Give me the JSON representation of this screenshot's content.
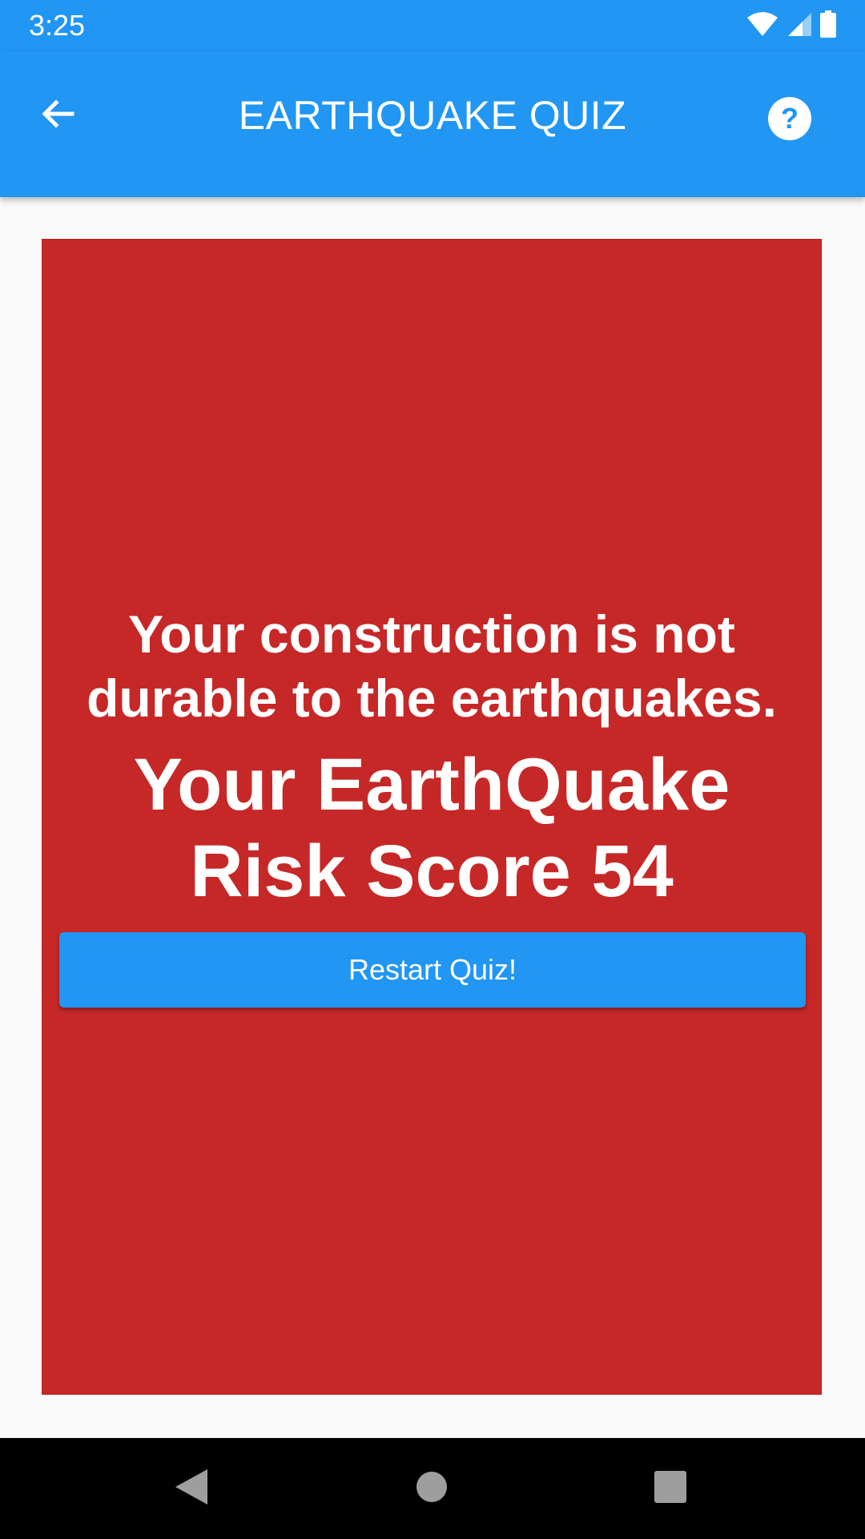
{
  "status_bar": {
    "time": "3:25",
    "icons": [
      "wifi-icon",
      "cellular-signal-icon",
      "battery-icon"
    ]
  },
  "app_bar": {
    "title": "EARTHQUAKE QUIZ",
    "back_icon": "arrow-back-icon",
    "help_icon": "help-circle-icon",
    "color": "#2196f3"
  },
  "result": {
    "message": "Your construction is not durable to the earthquakes.",
    "score_text": "Your EarthQuake Risk Score 54",
    "card_color": "#c62828",
    "button_label": "Restart Quiz!",
    "button_color": "#2196f3"
  },
  "nav_bar": {
    "icons": [
      "back-triangle-icon",
      "home-circle-icon",
      "recents-square-icon"
    ]
  }
}
